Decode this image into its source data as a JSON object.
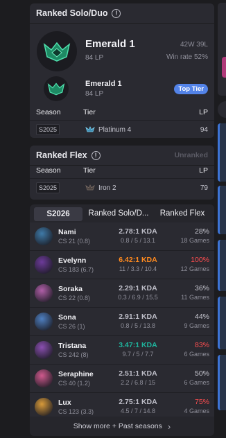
{
  "solo": {
    "title": "Ranked Solo/Duo",
    "tier": "Emerald 1",
    "lp": "84 LP",
    "record": "42W 39L",
    "winrate": "Win rate 52%",
    "peak_tier": "Emerald 1",
    "peak_lp": "84 LP",
    "peak_badge": "Top Tier",
    "col_season": "Season",
    "col_tier": "Tier",
    "col_lp": "LP",
    "rows": [
      {
        "season": "S2025",
        "tier": "Platinum 4",
        "lp": "94"
      }
    ]
  },
  "flex": {
    "title": "Ranked Flex",
    "status": "Unranked",
    "col_season": "Season",
    "col_tier": "Tier",
    "col_lp": "LP",
    "rows": [
      {
        "season": "S2025",
        "tier": "Iron 2",
        "lp": "79"
      }
    ]
  },
  "tabs": [
    "S2026",
    "Ranked Solo/D...",
    "Ranked Flex"
  ],
  "champions": [
    {
      "name": "Nami",
      "cs": "CS 21 (0.8)",
      "kda": "2.78:1 KDA",
      "kda_detail": "0.8 / 5 / 13.1",
      "winrate": "28%",
      "games": "18 Games",
      "kda_color": "#bfbfc9",
      "wr_color": "#c9c9d2",
      "avatar_color": "#3f7aa8"
    },
    {
      "name": "Evelynn",
      "cs": "CS 183 (6.7)",
      "kda": "6.42:1 KDA",
      "kda_detail": "11 / 3.3 / 10.4",
      "winrate": "100%",
      "games": "12 Games",
      "kda_color": "#ff8a1f",
      "wr_color": "#ff4e50",
      "avatar_color": "#6d3b9a"
    },
    {
      "name": "Soraka",
      "cs": "CS 22 (0.8)",
      "kda": "2.29:1 KDA",
      "kda_detail": "0.3 / 6.9 / 15.5",
      "winrate": "36%",
      "games": "11 Games",
      "kda_color": "#bfbfc9",
      "wr_color": "#c9c9d2",
      "avatar_color": "#b05fa8"
    },
    {
      "name": "Sona",
      "cs": "CS 26 (1)",
      "kda": "2.91:1 KDA",
      "kda_detail": "0.8 / 5 / 13.8",
      "winrate": "44%",
      "games": "9 Games",
      "kda_color": "#bfbfc9",
      "wr_color": "#c9c9d2",
      "avatar_color": "#4f7fc0"
    },
    {
      "name": "Tristana",
      "cs": "CS 242 (8)",
      "kda": "3.47:1 KDA",
      "kda_detail": "9.7 / 5 / 7.7",
      "winrate": "83%",
      "games": "6 Games",
      "kda_color": "#1fb39c",
      "wr_color": "#ff4e50",
      "avatar_color": "#8a4fb0"
    },
    {
      "name": "Seraphine",
      "cs": "CS 40 (1.2)",
      "kda": "2.51:1 KDA",
      "kda_detail": "2.2 / 6.8 / 15",
      "winrate": "50%",
      "games": "6 Games",
      "kda_color": "#bfbfc9",
      "wr_color": "#c9c9d2",
      "avatar_color": "#d05a8e"
    },
    {
      "name": "Lux",
      "cs": "CS 123 (3.3)",
      "kda": "2.75:1 KDA",
      "kda_detail": "4.5 / 7 / 14.8",
      "winrate": "75%",
      "games": "4 Games",
      "kda_color": "#bfbfc9",
      "wr_color": "#ff4e50",
      "avatar_color": "#d89a3a"
    }
  ],
  "show_more": "Show more + Past seasons",
  "colors": {
    "top_tier_badge": "#5383e8",
    "emerald": "#2fbf8f",
    "accent_blue": "#3d74d6"
  }
}
